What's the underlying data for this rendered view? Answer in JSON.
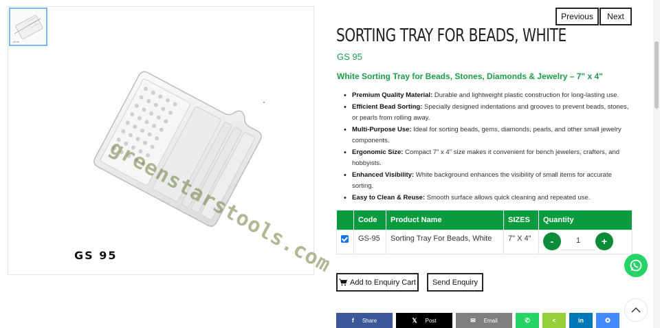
{
  "gallery": {
    "watermark": "greenstarstools.com",
    "caption": "GS 95"
  },
  "pager": {
    "previous_label": "Previous",
    "next_label": "Next"
  },
  "product": {
    "title": "SORTING TRAY FOR BEADS, WHITE",
    "sku": "GS 95",
    "subtitle": "White Sorting Tray for Beads, Stones, Diamonds & Jewelry – 7\" x 4\"",
    "features": [
      {
        "label": "Premium Quality Material:",
        "text": " Durable and lightweight plastic construction for long-lasting use."
      },
      {
        "label": "Efficient Bead Sorting:",
        "text": " Specially designed indentations and grooves to prevent beads, stones, or pearls from rolling away."
      },
      {
        "label": "Multi-Purpose Use:",
        "text": " Ideal for sorting beads, gems, diamonds, pearls, and other small jewelry components."
      },
      {
        "label": "Ergonomic Size:",
        "text": " Compact 7\" x 4\" size makes it convenient for bench jewelers, crafters, and hobbyists."
      },
      {
        "label": "Enhanced Visibility:",
        "text": " White background enhances the visibility of small items for accurate sorting."
      },
      {
        "label": "Easy to Clean & Reuse:",
        "text": " Smooth surface allows quick cleaning and repeated use."
      }
    ]
  },
  "table": {
    "headers": {
      "code": "Code",
      "name": "Product Name",
      "sizes": "SIZES",
      "quantity": "Quantity"
    },
    "row": {
      "checked": true,
      "code": "GS-95",
      "name": "Sorting Tray For Beads, White",
      "size": "7\" X 4\"",
      "quantity": "1",
      "minus": "-",
      "plus": "+"
    }
  },
  "actions": {
    "add_cart_label": "Add to Enquiry Cart",
    "enquiry_label": "Send Enquiry"
  },
  "share": [
    {
      "id": "facebook",
      "icon": "f",
      "label": "Share",
      "color": "#3b5998"
    },
    {
      "id": "x",
      "icon": "𝕏",
      "label": "Post",
      "color": "#000000"
    },
    {
      "id": "email",
      "icon": "✉",
      "label": "Email",
      "color": "#7f7f7f"
    },
    {
      "id": "whatsapp",
      "icon": "✆",
      "label": "",
      "color": "#25d366"
    },
    {
      "id": "sharethis",
      "icon": "<",
      "label": "",
      "color": "#95d03a"
    },
    {
      "id": "linkedin",
      "icon": "in",
      "label": "",
      "color": "#0077b5"
    },
    {
      "id": "messenger",
      "icon": "✪",
      "label": "",
      "color": "#448aff"
    }
  ],
  "colors": {
    "accent_green": "#0a9b3e",
    "text_green": "#1e9c48"
  }
}
